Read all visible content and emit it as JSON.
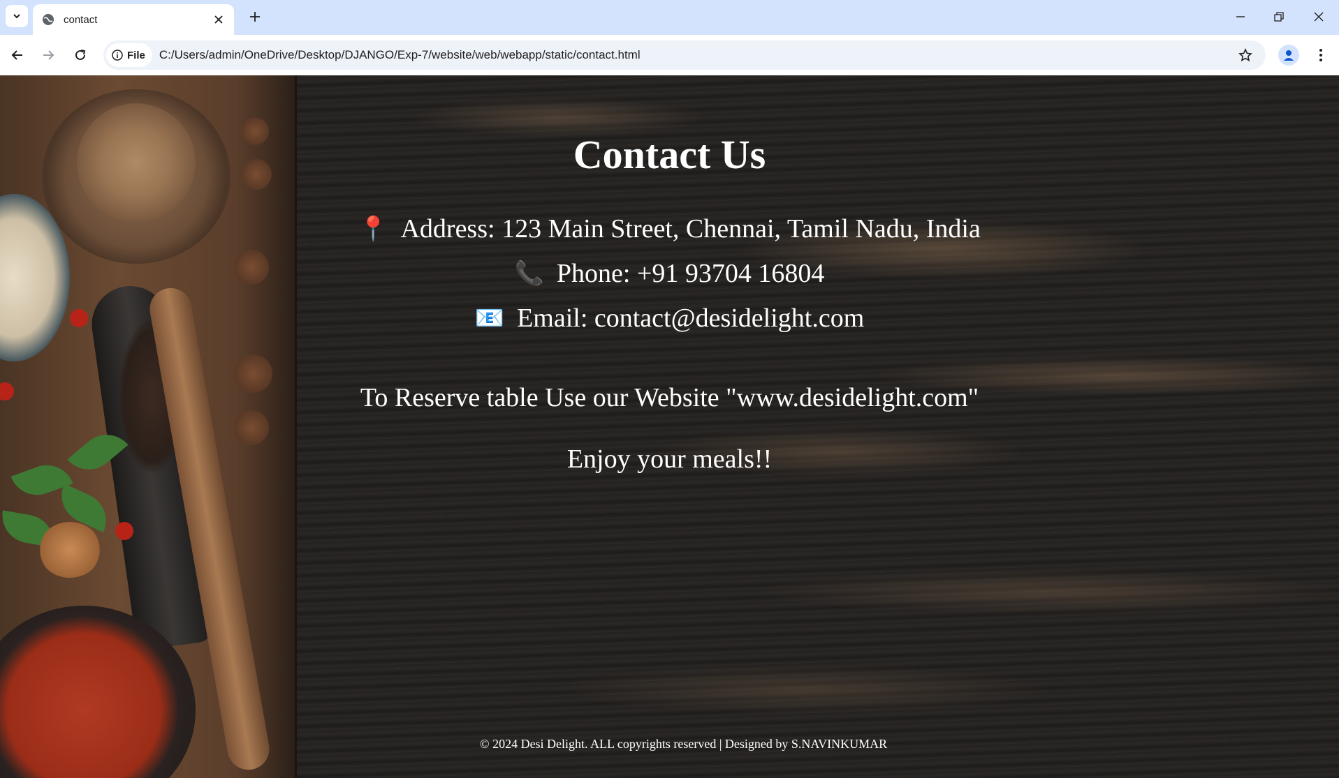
{
  "browser": {
    "tab_title": "contact",
    "site_chip_label": "File",
    "url": "C:/Users/admin/OneDrive/Desktop/DJANGO/Exp-7/website/web/webapp/static/contact.html"
  },
  "page": {
    "title": "Contact Us",
    "address_icon": "📍",
    "address": "Address: 123 Main Street, Chennai, Tamil Nadu, India",
    "phone_icon": "📞",
    "phone": "Phone: +91 93704 16804",
    "email_icon": "📧",
    "email": "Email: contact@desidelight.com",
    "reserve_text": "To Reserve table Use our Website \"www.desidelight.com\"",
    "enjoy_text": "Enjoy your meals!!",
    "footer_text": "© 2024 Desi Delight. ALL copyrights reserved | Designed by S.NAVINKUMAR"
  },
  "colors": {
    "tabstrip": "#d3e3fd",
    "page_text": "#ffffff",
    "background_wood": "#252321"
  },
  "icons": {
    "tab_search": "chevron-down-icon",
    "favicon": "globe-icon",
    "tab_close": "close-icon",
    "new_tab": "plus-icon",
    "minimize": "minimize-icon",
    "restore": "restore-icon",
    "close_window": "close-icon",
    "back": "back-arrow-icon",
    "forward": "forward-arrow-icon",
    "reload": "reload-icon",
    "site_info": "info-icon",
    "bookmark": "star-icon",
    "profile": "profile-icon",
    "menu": "kebab-menu-icon"
  }
}
